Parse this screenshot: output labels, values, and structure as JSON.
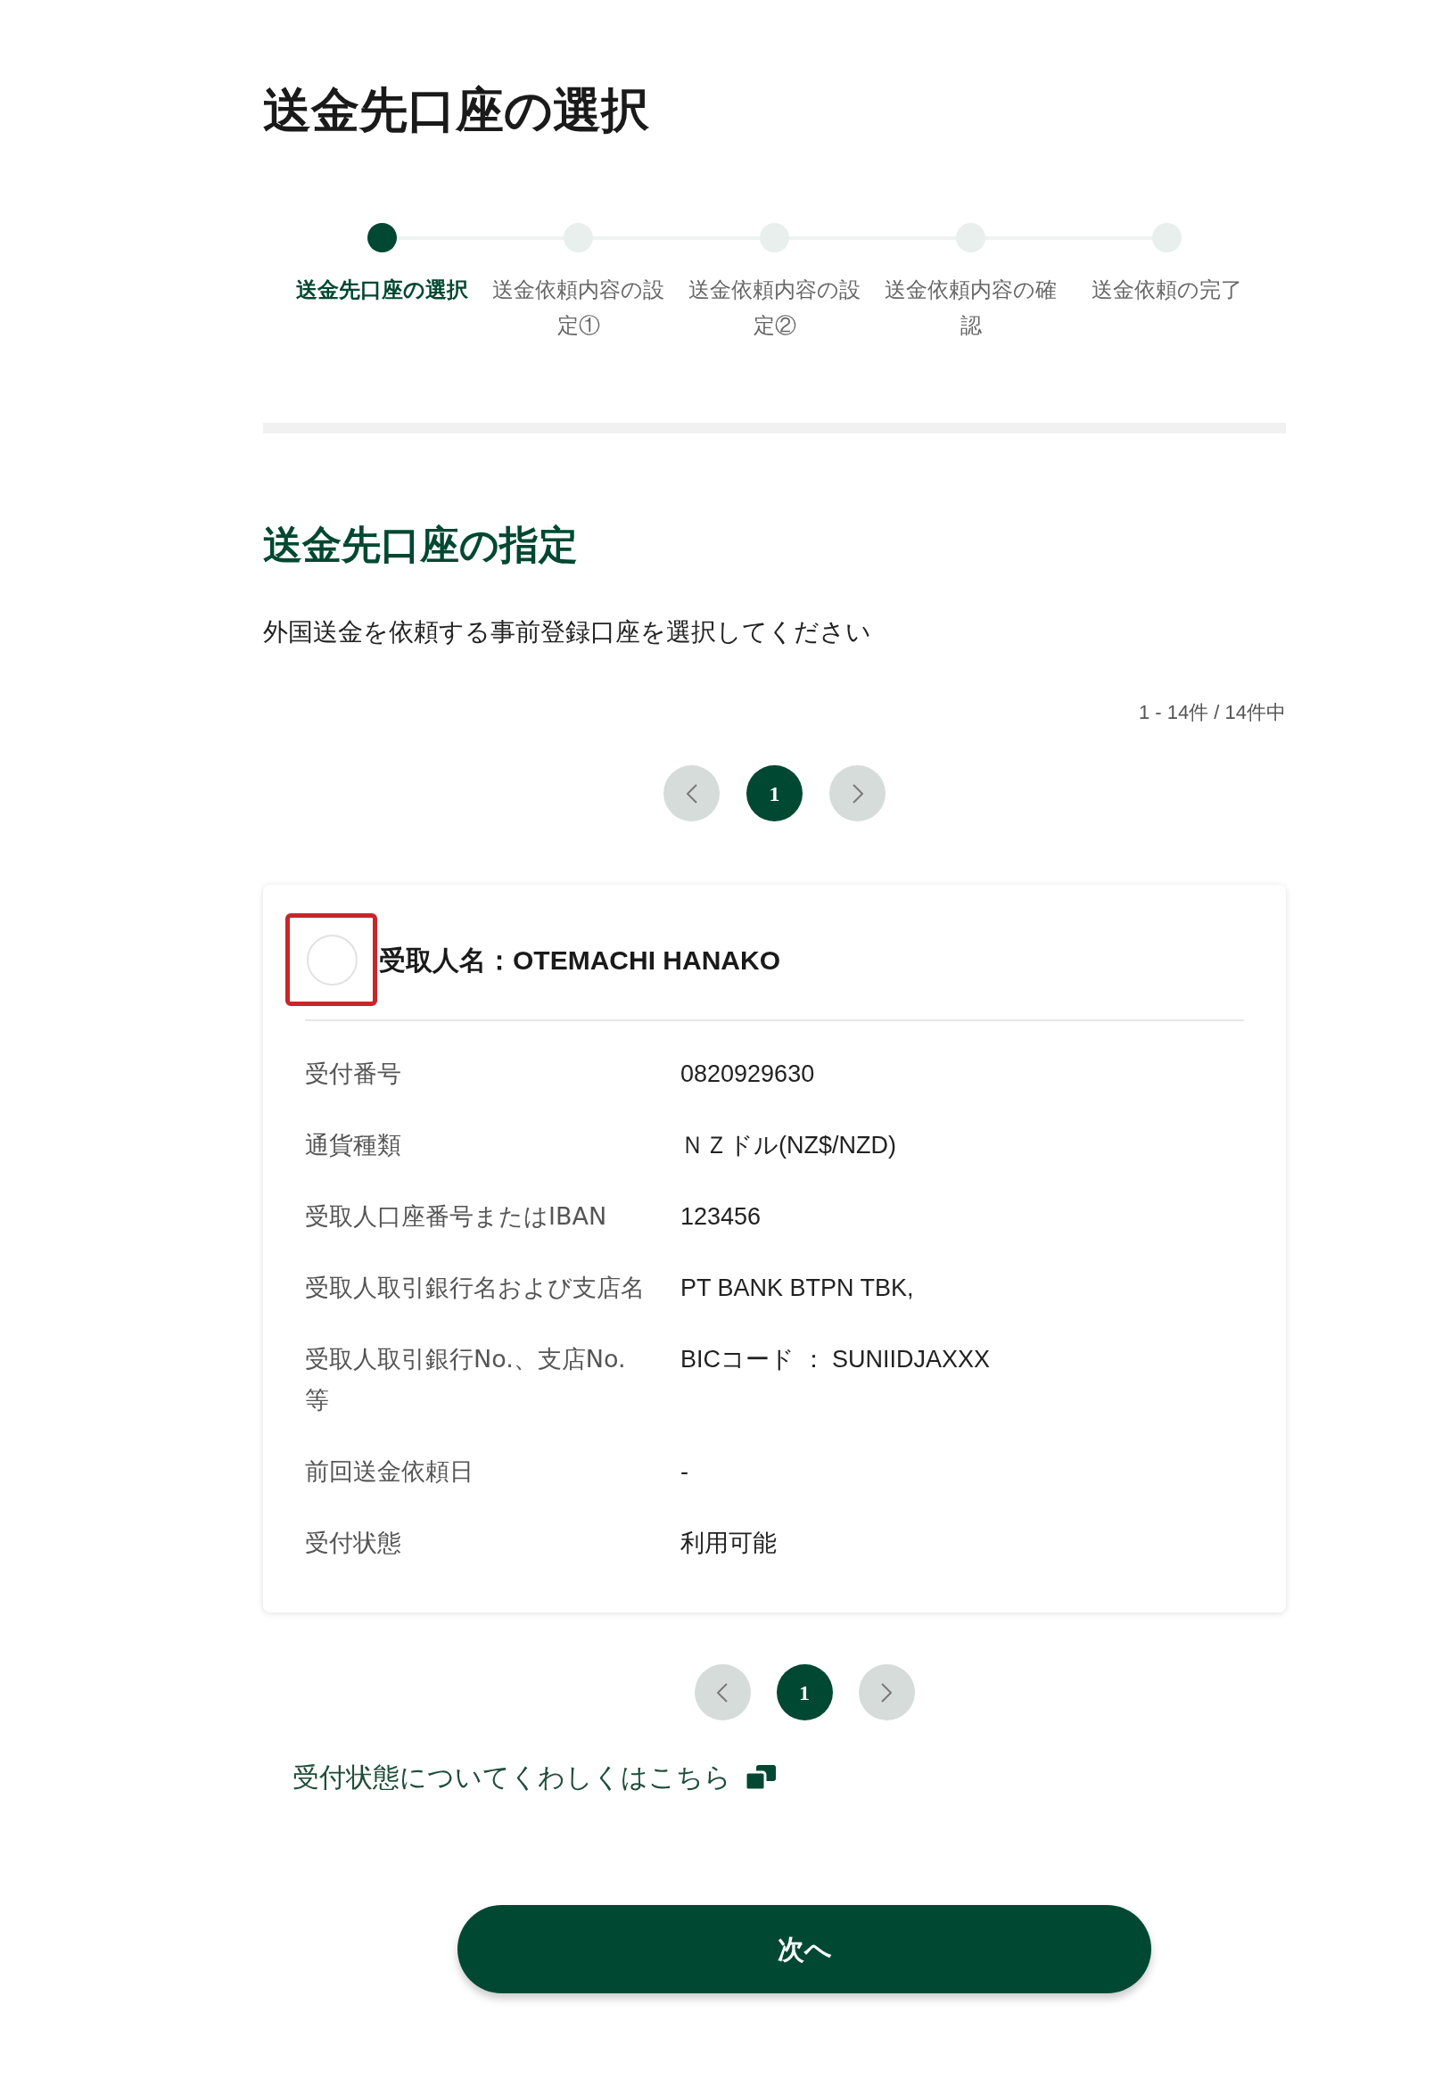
{
  "page": {
    "title": "送金先口座の選択"
  },
  "stepper": {
    "steps": [
      {
        "label": "送金先口座の選択",
        "selected": true
      },
      {
        "label": "送金依頼内容の設定①",
        "selected": false
      },
      {
        "label": "送金依頼内容の設定②",
        "selected": false
      },
      {
        "label": "送金依頼内容の確認",
        "selected": false
      },
      {
        "label": "送金依頼の完了",
        "selected": false
      }
    ]
  },
  "section": {
    "heading": "送金先口座の指定",
    "instruction": "外国送金を依頼する事前登録口座を選択してください",
    "count": "1 - 14件 / 14件中"
  },
  "pagination_top": {
    "previous": {
      "disabled": true
    },
    "pages": [
      {
        "label": "1",
        "selected": true
      }
    ],
    "next": {
      "disabled": true
    }
  },
  "accounts": [
    {
      "selected": false,
      "highlighted": true,
      "recipient": "受取人名：OTEMACHI HANAKO",
      "fields": [
        {
          "label": "受付番号",
          "value": "0820929630"
        },
        {
          "label": "通貨種類",
          "value": "ＮＺドル(NZ$/NZD)"
        },
        {
          "label": "受取人口座番号またはIBAN",
          "value": "123456"
        },
        {
          "label": "受取人取引銀行名および支店名",
          "value": "PT BANK BTPN TBK,"
        },
        {
          "label": "受取人取引銀行No.、支店No.等",
          "value": "BICコード ： SUNIIDJAXXX"
        },
        {
          "label": "前回送金依頼日",
          "value": "-"
        },
        {
          "label": "受付状態",
          "value": "利用可能"
        }
      ]
    }
  ],
  "pagination_bottom": {
    "previous": {
      "disabled": true
    },
    "pages": [
      {
        "label": "1",
        "selected": true
      }
    ],
    "next": {
      "disabled": true
    }
  },
  "help_link": {
    "label": "受付状態についてくわしくはこちら"
  },
  "next_button": {
    "label": "次へ"
  }
}
